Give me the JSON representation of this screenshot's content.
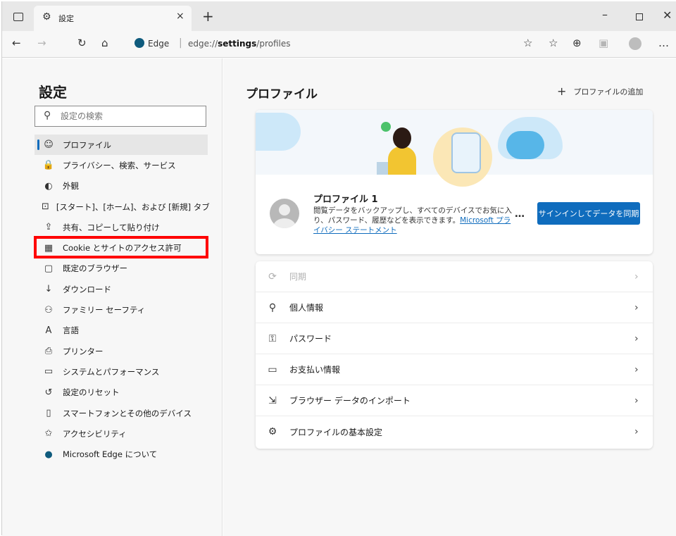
{
  "tab": {
    "icon": "gear-icon",
    "title": "設定",
    "close": "×",
    "new": "+"
  },
  "window": {
    "minimize": "–",
    "close": "✕"
  },
  "toolbar": {
    "back": "←",
    "forward": "→",
    "refresh": "↻",
    "home": "⌂",
    "brand": "Edge",
    "separator": "|",
    "url_prefix": "edge://",
    "url_path": "settings",
    "url_suffix": "/profiles",
    "add_favorite": "☆",
    "favorites": "☆",
    "collections": "⊕",
    "more": "…"
  },
  "sidebar": {
    "title": "設定",
    "search_placeholder": "設定の検索",
    "items": [
      {
        "label": "プロファイル",
        "icon": "☺",
        "active": true
      },
      {
        "label": "プライバシー、検索、サービス",
        "icon": "🔒"
      },
      {
        "label": "外観",
        "icon": "◐"
      },
      {
        "label": "[スタート]、[ホーム]、および [新規] タブ",
        "icon": "⊡"
      },
      {
        "label": "共有、コピーして貼り付け",
        "icon": "⇪"
      },
      {
        "label": "Cookie とサイトのアクセス許可",
        "icon": "▦"
      },
      {
        "label": "既定のブラウザー",
        "icon": "▢"
      },
      {
        "label": "ダウンロード",
        "icon": "↓"
      },
      {
        "label": "ファミリー セーフティ",
        "icon": "⚇"
      },
      {
        "label": "言語",
        "icon": "A"
      },
      {
        "label": "プリンター",
        "icon": "⎙"
      },
      {
        "label": "システムとパフォーマンス",
        "icon": "▭"
      },
      {
        "label": "設定のリセット",
        "icon": "↺"
      },
      {
        "label": "スマートフォンとその他のデバイス",
        "icon": "▯"
      },
      {
        "label": "アクセシビリティ",
        "icon": "✩"
      },
      {
        "label": "Microsoft Edge について",
        "icon": "●"
      }
    ]
  },
  "main": {
    "title": "プロファイル",
    "add_profile_plus": "+",
    "add_profile": "プロファイルの追加",
    "profile": {
      "name": "プロファイル 1",
      "description": "閲覧データをバックアップし、すべてのデバイスでお気に入り、パスワード、履歴などを表示できます。",
      "privacy_link": "Microsoft プライバシー ステートメント",
      "more": "…",
      "signin": "サインインしてデータを同期"
    },
    "rows": [
      {
        "label": "同期",
        "icon": "⟳",
        "disabled": true
      },
      {
        "label": "個人情報",
        "icon": "⚲"
      },
      {
        "label": "パスワード",
        "icon": "⚿"
      },
      {
        "label": "お支払い情報",
        "icon": "▭"
      },
      {
        "label": "ブラウザー データのインポート",
        "icon": "⇲"
      },
      {
        "label": "プロファイルの基本設定",
        "icon": "⚙"
      }
    ],
    "chevron": "›"
  },
  "colors": {
    "accent": "#0f6cbd",
    "highlight": "#ff0000",
    "background": "#f7f7f7"
  }
}
